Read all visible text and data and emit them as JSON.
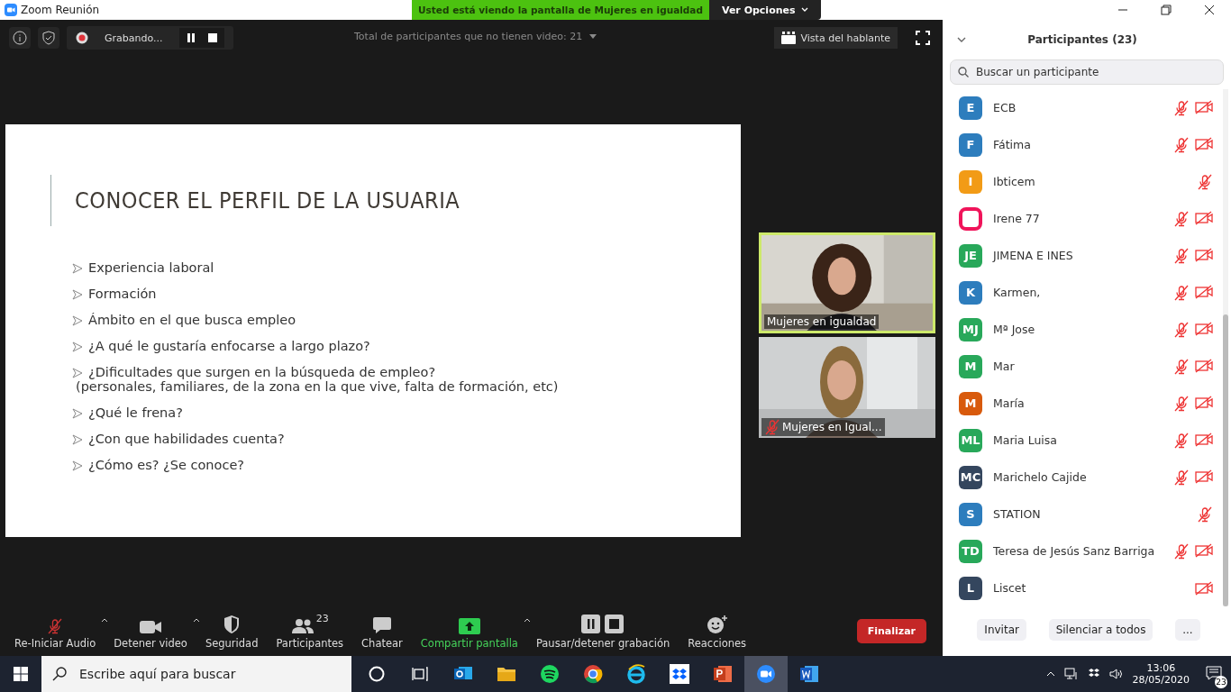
{
  "window": {
    "title": "Zoom Reunión"
  },
  "banner": {
    "text": "Usted está viendo la pantalla de Mujeres en igualdad",
    "options": "Ver Opciones"
  },
  "top_bar": {
    "recording": "Grabando...",
    "no_video_count": "Total de participantes que no tienen video: 21",
    "view": "Vista del hablante"
  },
  "slide": {
    "title": "CONOCER EL PERFIL DE LA USUARIA",
    "bullets": [
      {
        "text": "Experiencia laboral"
      },
      {
        "text": "Formación"
      },
      {
        "text": "Ámbito en el que busca empleo"
      },
      {
        "text": "¿A qué le gustaría enfocarse a largo plazo?"
      },
      {
        "text": "¿Dificultades que surgen en la búsqueda de empleo?",
        "note": "(personales, familiares, de la zona en la que vive, falta de formación, etc)"
      },
      {
        "text": "¿Qué le frena?"
      },
      {
        "text": "¿Con que habilidades cuenta?"
      },
      {
        "text": "¿Cómo es? ¿Se conoce?"
      }
    ]
  },
  "videos": [
    {
      "name": "Mujeres en igualdad",
      "speaking": true,
      "muted": false
    },
    {
      "name": "Mujeres en Igual...",
      "speaking": false,
      "muted": true
    }
  ],
  "toolbar": [
    {
      "kind": "mic",
      "label": "Re-Iniciar Audio",
      "caret": true
    },
    {
      "kind": "camera",
      "label": "Detener video",
      "caret": true
    },
    {
      "kind": "shield",
      "label": "Seguridad",
      "caret": false
    },
    {
      "kind": "people",
      "label": "Participantes",
      "count": "23",
      "caret": false
    },
    {
      "kind": "chat",
      "label": "Chatear",
      "caret": false
    },
    {
      "kind": "share",
      "label": "Compartir pantalla",
      "caret": true
    },
    {
      "kind": "record",
      "label": "Pausar/detener grabación",
      "caret": false
    },
    {
      "kind": "react",
      "label": "Reacciones",
      "caret": false
    }
  ],
  "end_button": "Finalizar",
  "panel": {
    "title": "Participantes (23)",
    "search": {
      "placeholder": "Buscar un participante"
    },
    "participants": [
      {
        "initials": "E",
        "name": "ECB",
        "color": "#2d7dbd",
        "mic_muted": true,
        "video_off": true
      },
      {
        "initials": "F",
        "name": "Fátima",
        "color": "#2d7dbd",
        "mic_muted": true,
        "video_off": true
      },
      {
        "initials": "I",
        "name": "Ibticem",
        "color": "#f29b16",
        "mic_muted": true,
        "video_off": false
      },
      {
        "kind": "ring",
        "name": "Irene 77",
        "color": "#f0145a",
        "mic_muted": true,
        "video_off": true
      },
      {
        "initials": "JE",
        "name": "JIMENA E INES",
        "color": "#28a85a",
        "mic_muted": true,
        "video_off": true
      },
      {
        "initials": "K",
        "name": "Karmen,",
        "color": "#2d7dbd",
        "mic_muted": true,
        "video_off": true
      },
      {
        "initials": "MJ",
        "name": "Mª Jose",
        "color": "#28a85a",
        "mic_muted": true,
        "video_off": true
      },
      {
        "initials": "M",
        "name": "Mar",
        "color": "#28a85a",
        "mic_muted": true,
        "video_off": true
      },
      {
        "initials": "M",
        "name": "María",
        "color": "#d85a0c",
        "mic_muted": true,
        "video_off": true
      },
      {
        "initials": "ML",
        "name": "Maria Luisa",
        "color": "#28a85a",
        "mic_muted": true,
        "video_off": true
      },
      {
        "initials": "MC",
        "name": "Marichelo Cajide",
        "color": "#34465e",
        "mic_muted": true,
        "video_off": true
      },
      {
        "initials": "S",
        "name": "STATION",
        "color": "#2d7dbd",
        "mic_muted": true,
        "video_off": false
      },
      {
        "initials": "TD",
        "name": "Teresa de Jesús Sanz Barriga",
        "color": "#28a85a",
        "mic_muted": true,
        "video_off": true
      },
      {
        "initials": "L",
        "name": "Liscet",
        "color": "#34465e",
        "mic_muted": false,
        "video_off": true
      }
    ],
    "buttons": [
      "Invitar",
      "Silenciar a todos",
      "..."
    ]
  },
  "taskbar": {
    "search": {
      "placeholder": "Escribe aquí para buscar"
    },
    "time": "13:06",
    "date": "28/05/2020",
    "notifications": "23"
  }
}
